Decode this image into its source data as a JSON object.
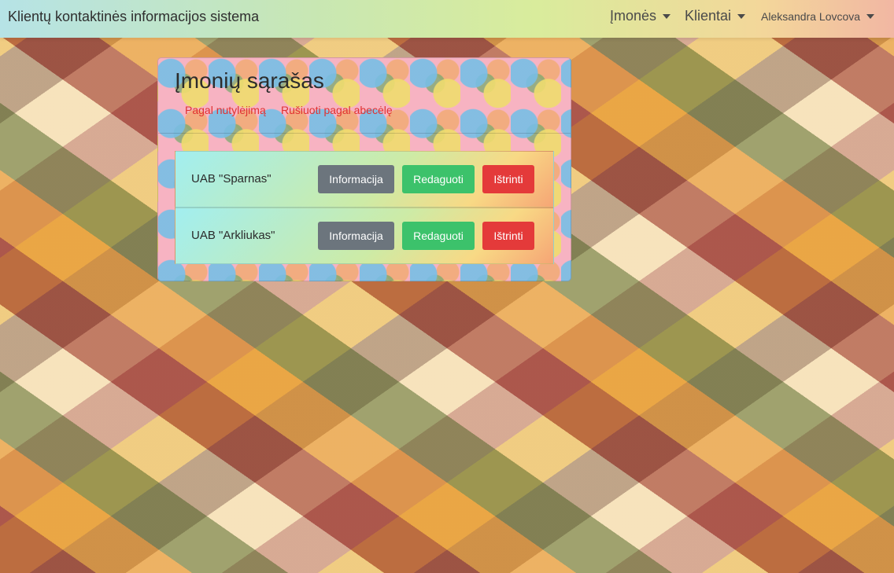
{
  "navbar": {
    "brand": "Klientų kontaktinės informacijos sistema",
    "menu_companies": "Įmonės",
    "menu_clients": "Klientai",
    "user_name": "Aleksandra Lovcova"
  },
  "panel": {
    "title": "Įmonių sąrašas",
    "sort_default": "Pagal nutylėjimą",
    "sort_alphabet": "Rušiuoti pagal abecėlę"
  },
  "companies": [
    {
      "name": "UAB \"Sparnas\"",
      "info_label": "Informacija",
      "edit_label": "Redaguoti",
      "delete_label": "Ištrinti"
    },
    {
      "name": "UAB \"Arkliukas\"",
      "info_label": "Informacija",
      "edit_label": "Redaguoti",
      "delete_label": "Ištrinti"
    }
  ],
  "colors": {
    "link": "#e03131",
    "info_button": "#6c757d",
    "edit_button": "#3cc26b",
    "delete_button": "#e43a3a"
  },
  "icons": {
    "dropdown": "caret-down-icon"
  }
}
